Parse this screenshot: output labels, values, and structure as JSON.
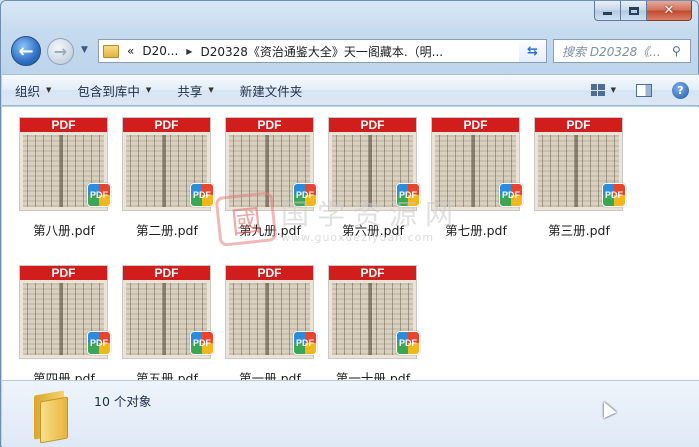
{
  "window": {
    "caption_buttons": {
      "minimize": "minimize",
      "maximize": "maximize",
      "close": "✕"
    }
  },
  "nav": {
    "back": "back",
    "forward": "forward",
    "breadcrumb": {
      "overflow": "«",
      "segments": [
        "D20...",
        "D20328《资治通鉴大全》天一阁藏本.（明..."
      ]
    },
    "search": {
      "placeholder": "搜索 D20328《..."
    }
  },
  "commands": [
    {
      "label": "组织",
      "has_dropdown": true
    },
    {
      "label": "包含到库中",
      "has_dropdown": true
    },
    {
      "label": "共享",
      "has_dropdown": true
    },
    {
      "label": "新建文件夹",
      "has_dropdown": false
    }
  ],
  "files": [
    {
      "name": "第八册.pdf",
      "thumb_header": "PDF",
      "badge": "PDF"
    },
    {
      "name": "第二册.pdf",
      "thumb_header": "PDF",
      "badge": "PDF"
    },
    {
      "name": "第九册.pdf",
      "thumb_header": "PDF",
      "badge": "PDF"
    },
    {
      "name": "第六册.pdf",
      "thumb_header": "PDF",
      "badge": "PDF"
    },
    {
      "name": "第七册.pdf",
      "thumb_header": "PDF",
      "badge": "PDF"
    },
    {
      "name": "第三册.pdf",
      "thumb_header": "PDF",
      "badge": "PDF"
    },
    {
      "name": "第四册.pdf",
      "thumb_header": "PDF",
      "badge": "PDF"
    },
    {
      "name": "第五册.pdf",
      "thumb_header": "PDF",
      "badge": "PDF"
    },
    {
      "name": "第一册.pdf",
      "thumb_header": "PDF",
      "badge": "PDF"
    },
    {
      "name": "第一十册.pdf",
      "thumb_header": "PDF",
      "badge": "PDF"
    }
  ],
  "watermark": {
    "seal": "國",
    "text_cn": "国学资源网",
    "url": "www.guoxueziyuan.com"
  },
  "details": {
    "count_text": "10 个对象"
  },
  "colors": {
    "pdf_red": "#d21d1d",
    "explorer_blue": "#bcd3eb"
  }
}
